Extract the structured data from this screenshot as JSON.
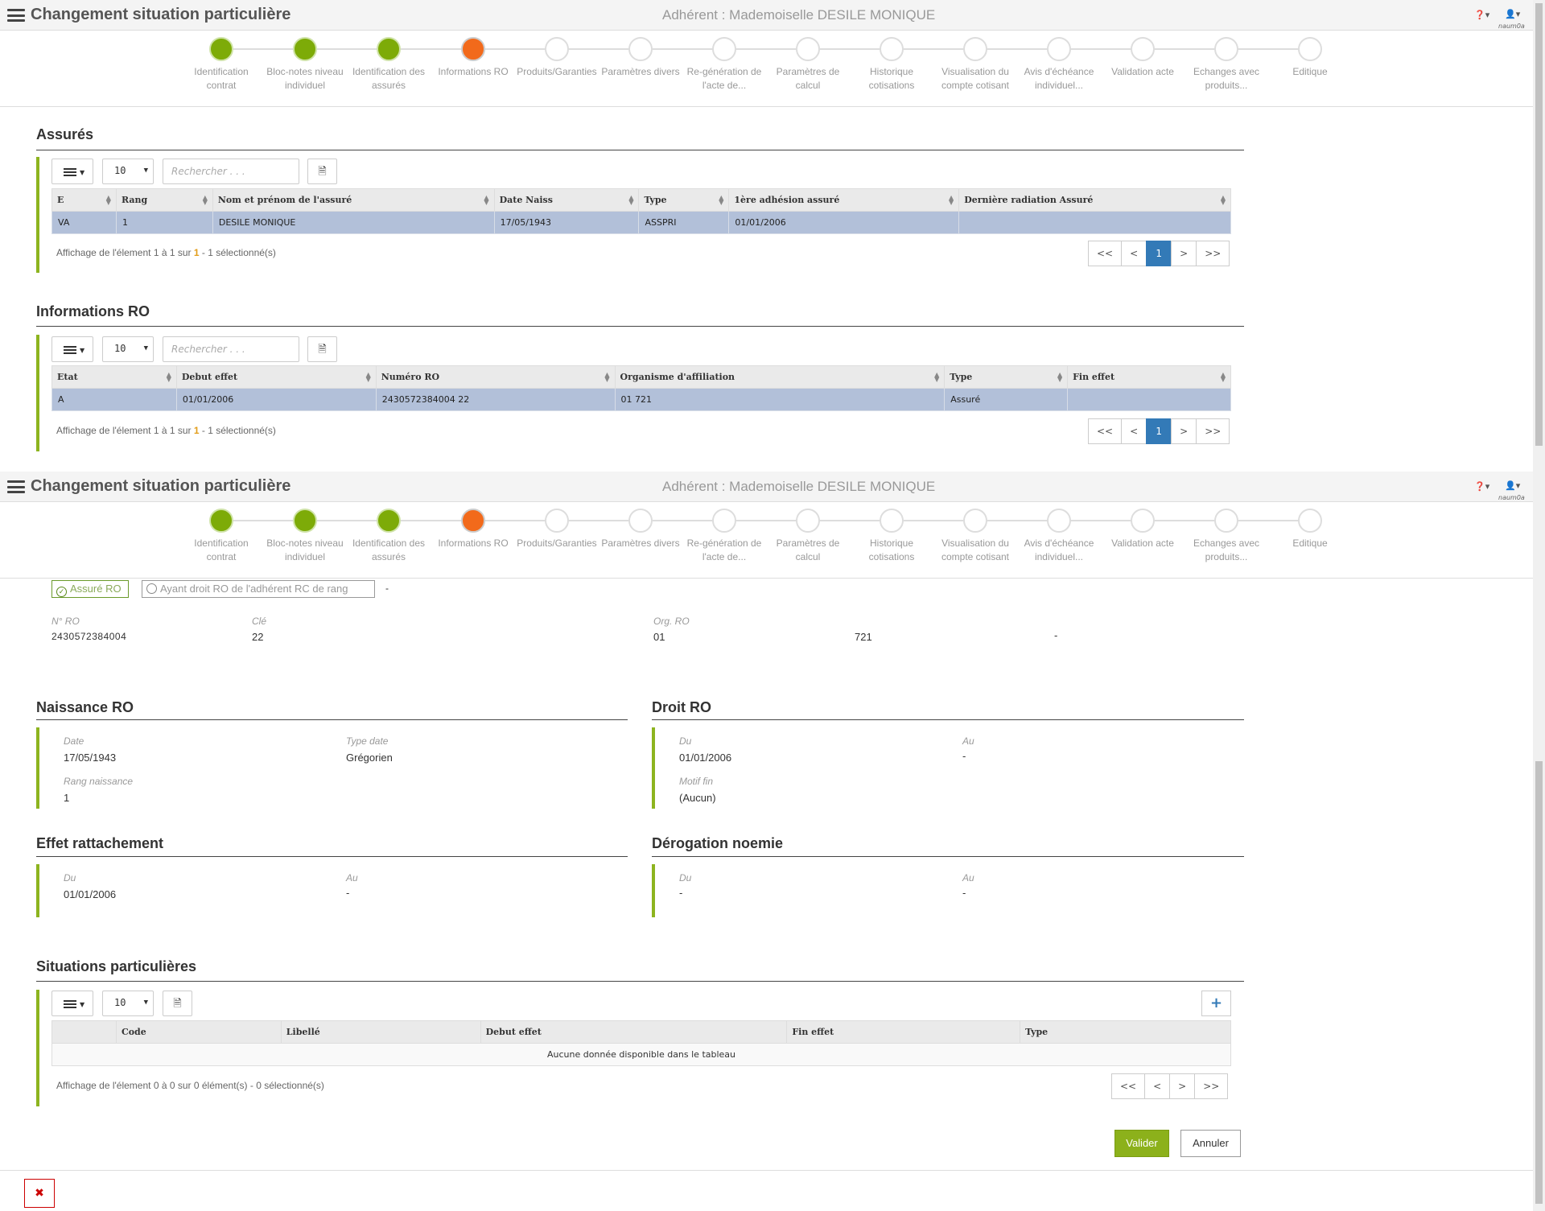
{
  "header": {
    "title": "Changement situation particulière",
    "adherent": "Adhérent : Mademoiselle DESILE MONIQUE",
    "user_name": "naum0a"
  },
  "wizard": {
    "steps": [
      {
        "label": "Identification contrat",
        "state": "done"
      },
      {
        "label": "Bloc-notes niveau individuel",
        "state": "done"
      },
      {
        "label": "Identification des assurés",
        "state": "done"
      },
      {
        "label": "Informations RO",
        "state": "current"
      },
      {
        "label": "Produits/Garanties",
        "state": "todo"
      },
      {
        "label": "Paramètres divers",
        "state": "todo"
      },
      {
        "label": "Re-génération de l'acte de...",
        "state": "todo"
      },
      {
        "label": "Paramètres de calcul",
        "state": "todo"
      },
      {
        "label": "Historique cotisations",
        "state": "todo"
      },
      {
        "label": "Visualisation du compte cotisant",
        "state": "todo"
      },
      {
        "label": "Avis d'échéance individuel...",
        "state": "todo"
      },
      {
        "label": "Validation acte",
        "state": "todo"
      },
      {
        "label": "Echanges avec produits...",
        "state": "todo"
      },
      {
        "label": "Editique",
        "state": "todo"
      }
    ]
  },
  "assures": {
    "title": "Assurés",
    "page_size": "10",
    "search_placeholder": "Rechercher . . .",
    "columns": [
      "E",
      "Rang",
      "Nom et prénom de l'assuré",
      "Date Naiss",
      "Type",
      "1ère adhésion assuré",
      "Dernière radiation Assuré"
    ],
    "rows": [
      [
        "VA",
        "1",
        "DESILE MONIQUE",
        "17/05/1943",
        "ASSPRI",
        "01/01/2006",
        ""
      ]
    ],
    "info_prefix": "Affichage de l'élement 1 à 1 sur ",
    "info_count": "1",
    "info_suffix": " - 1 sélectionné(s)",
    "pager": [
      "<<",
      "<",
      "1",
      ">",
      ">>"
    ]
  },
  "infos_ro": {
    "title": "Informations RO",
    "page_size": "10",
    "search_placeholder": "Rechercher . . .",
    "columns": [
      "Etat",
      "Debut effet",
      "Numéro RO",
      "Organisme d'affiliation",
      "Type",
      "Fin effet"
    ],
    "rows": [
      [
        "A",
        "01/01/2006",
        "2430572384004 22",
        "01 721",
        "Assuré",
        ""
      ]
    ],
    "info_prefix": "Affichage de l'élement 1 à 1 sur ",
    "info_count": "1",
    "info_suffix": " - 1 sélectionné(s)",
    "pager": [
      "<<",
      "<",
      "1",
      ">",
      ">>"
    ]
  },
  "ro_details": {
    "radio_assure": "Assuré RO",
    "radio_ayant_droit": "Ayant droit RO de l'adhérent RC de rang",
    "radio_dash": "-",
    "num_ro_label": "N° RO",
    "num_ro": "2430572384004",
    "cle_label": "Clé",
    "cle": "22",
    "org_label": "Org. RO",
    "org1": "01",
    "org2": "721",
    "org3": "-"
  },
  "naissance": {
    "title": "Naissance RO",
    "date_label": "Date",
    "date": "17/05/1943",
    "type_label": "Type date",
    "type": "Grégorien",
    "rang_label": "Rang naissance",
    "rang": "1"
  },
  "droit": {
    "title": "Droit RO",
    "du_label": "Du",
    "du": "01/01/2006",
    "au_label": "Au",
    "au": "-",
    "motif_label": "Motif fin",
    "motif": "(Aucun)"
  },
  "effet": {
    "title": "Effet rattachement",
    "du_label": "Du",
    "du": "01/01/2006",
    "au_label": "Au",
    "au": "-"
  },
  "derogation": {
    "title": "Dérogation noemie",
    "du_label": "Du",
    "du": "-",
    "au_label": "Au",
    "au": "-"
  },
  "situations": {
    "title": "Situations particulières",
    "page_size": "10",
    "columns": [
      "",
      "Code",
      "Libellé",
      "Debut effet",
      "Fin effet",
      "Type"
    ],
    "empty": "Aucune donnée disponible dans le tableau",
    "info": "Affichage de l'élement 0 à 0 sur 0 élément(s) - 0 sélectionné(s)",
    "pager": [
      "<<",
      "<",
      ">",
      ">>"
    ]
  },
  "actions": {
    "valider": "Valider",
    "annuler": "Annuler",
    "close": "✖"
  },
  "colors": {
    "accent": "#8db41f",
    "done": "#7dab08",
    "current": "#f26a1b",
    "selected_row": "#b2c0d9",
    "page_active": "#337ab7"
  }
}
